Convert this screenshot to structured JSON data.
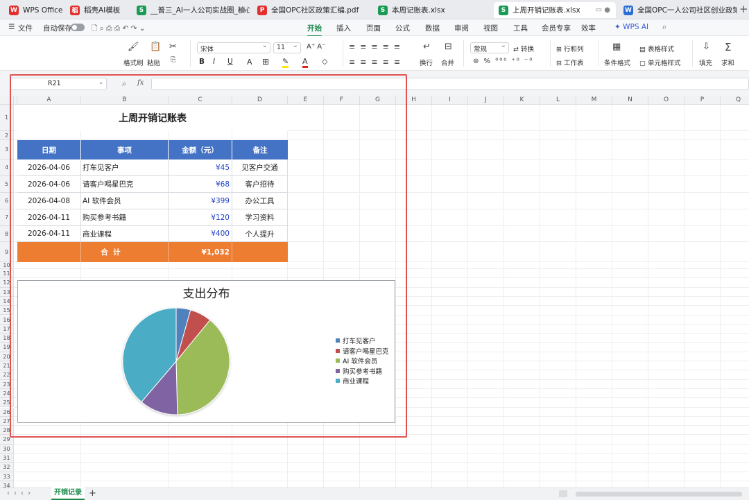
{
  "tabs": [
    {
      "label": "WPS Office",
      "icon": "W",
      "color": "#e3302f"
    },
    {
      "label": "稻壳AI模板",
      "icon": "稻",
      "color": "#e3302f"
    },
    {
      "label": "__普三_AI一人公司实战圈_核心成",
      "icon": "S",
      "color": "#1a9b55"
    },
    {
      "label": "全国OPC社区政策汇编.pdf",
      "icon": "P",
      "color": "#e3302f"
    },
    {
      "label": "本周记账表.xlsx",
      "icon": "S",
      "color": "#1a9b55"
    },
    {
      "label": "上周开销记账表.xlsx",
      "icon": "S",
      "color": "#1a9b55"
    },
    {
      "label": "全国OPC一人公司社区创业政策指南",
      "icon": "W",
      "color": "#2b6fd6"
    }
  ],
  "menubar": {
    "file": "文件",
    "autosave": "自动保存",
    "tabs": [
      "开始",
      "插入",
      "页面",
      "公式",
      "数据",
      "审阅",
      "视图",
      "工具",
      "会员专享",
      "效率",
      "WPS AI"
    ],
    "active": "开始"
  },
  "ribbon": {
    "format_painter": "格式刷",
    "paste": "粘贴",
    "font": "宋体",
    "size": "11",
    "bold": "B",
    "italic": "I",
    "underline": "U",
    "wrap": "换行",
    "merge": "合并",
    "numfmt": "常规",
    "convert": "转换",
    "rowcol": "行和列",
    "worksheet": "工作表",
    "cond_format": "条件格式",
    "table_style": "表格样式",
    "cell_style": "单元格样式",
    "fill": "填充",
    "sum": "求和"
  },
  "namebox": "R21",
  "fx": "fx",
  "columns": [
    "A",
    "B",
    "C",
    "D",
    "E",
    "F",
    "G",
    "H",
    "I",
    "J",
    "K",
    "L",
    "M",
    "N",
    "O",
    "P",
    "Q"
  ],
  "rows": [
    "1",
    "2",
    "3",
    "4",
    "5",
    "6",
    "7",
    "8",
    "9",
    "10",
    "11",
    "12",
    "13",
    "14",
    "15",
    "16",
    "17",
    "18",
    "19",
    "20",
    "21",
    "22",
    "23",
    "24",
    "25",
    "26",
    "27",
    "28",
    "29",
    "30",
    "31",
    "32",
    "33",
    "34"
  ],
  "sheet_title": "上周开销记账表",
  "table": {
    "headers": [
      "日期",
      "事项",
      "金额（元）",
      "备注"
    ],
    "rows": [
      [
        "2026-04-06",
        "打车见客户",
        "¥45",
        "见客户交通"
      ],
      [
        "2026-04-06",
        "请客户喝星巴克",
        "¥68",
        "客户招待"
      ],
      [
        "2026-04-08",
        "AI 软件会员",
        "¥399",
        "办公工具"
      ],
      [
        "2026-04-11",
        "购买参考书籍",
        "¥120",
        "学习资料"
      ],
      [
        "2026-04-11",
        "商业课程",
        "¥400",
        "个人提升"
      ]
    ],
    "total_label": "合  计",
    "total_value": "¥1,032"
  },
  "chart_data": {
    "type": "pie",
    "title": "支出分布",
    "categories": [
      "打车见客户",
      "请客户喝星巴克",
      "AI 软件会员",
      "购买参考书籍",
      "商业课程"
    ],
    "values": [
      45,
      68,
      399,
      120,
      400
    ],
    "colors": [
      "#4f81bd",
      "#c0504d",
      "#9bbb59",
      "#8064a2",
      "#4bacc6"
    ],
    "legend": "right"
  },
  "sheet_tab": "开销记录"
}
